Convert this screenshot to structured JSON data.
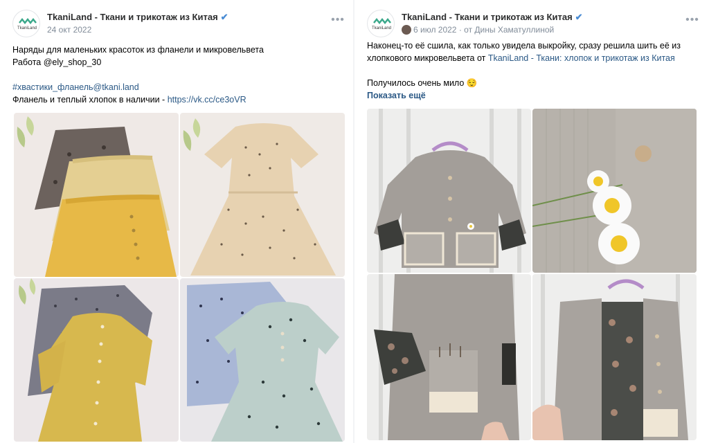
{
  "left_post": {
    "author": "TkaniLand - Ткани и трикотаж из Китая",
    "date": "24 окт 2022",
    "avatar_text": "TkaniLand",
    "line1": "Наряды для маленьких красоток из фланели и микровельвета",
    "line2": "Работа @ely_shop_30",
    "hashtag": "#хвастики_фланель@tkani.land",
    "line4_text": "Фланель и теплый хлопок в наличии - ",
    "line4_link": "https://vk.cc/ce3oVR",
    "photos": [
      "skirts-photo",
      "floral-dress-photo",
      "yellow-dress-photo",
      "polka-dot-dresses-photo"
    ]
  },
  "right_post": {
    "author": "TkaniLand - Ткани и трикотаж из Китая",
    "date": "6 июл 2022",
    "from": "от Дины Хаматуллиной",
    "avatar_text": "TkaniLand",
    "line1": "Наконец-то её сшила, как только увидела выкройку, сразу решила шить её из",
    "line2_text": "хлопкового микровельвета от ",
    "line2_link": "TkaniLand - Ткани: хлопок и трикотаж из Китая",
    "line3": "Получилось очень мило 😌",
    "show_more": "Показать ещё",
    "photos": [
      "jacket-front-photo",
      "jacket-detail-photo",
      "jacket-pocket-photo",
      "jacket-lining-photo"
    ]
  },
  "colors": {
    "link": "#2a5885",
    "secondary": "#818c99",
    "verify": "#4a8cd4"
  }
}
